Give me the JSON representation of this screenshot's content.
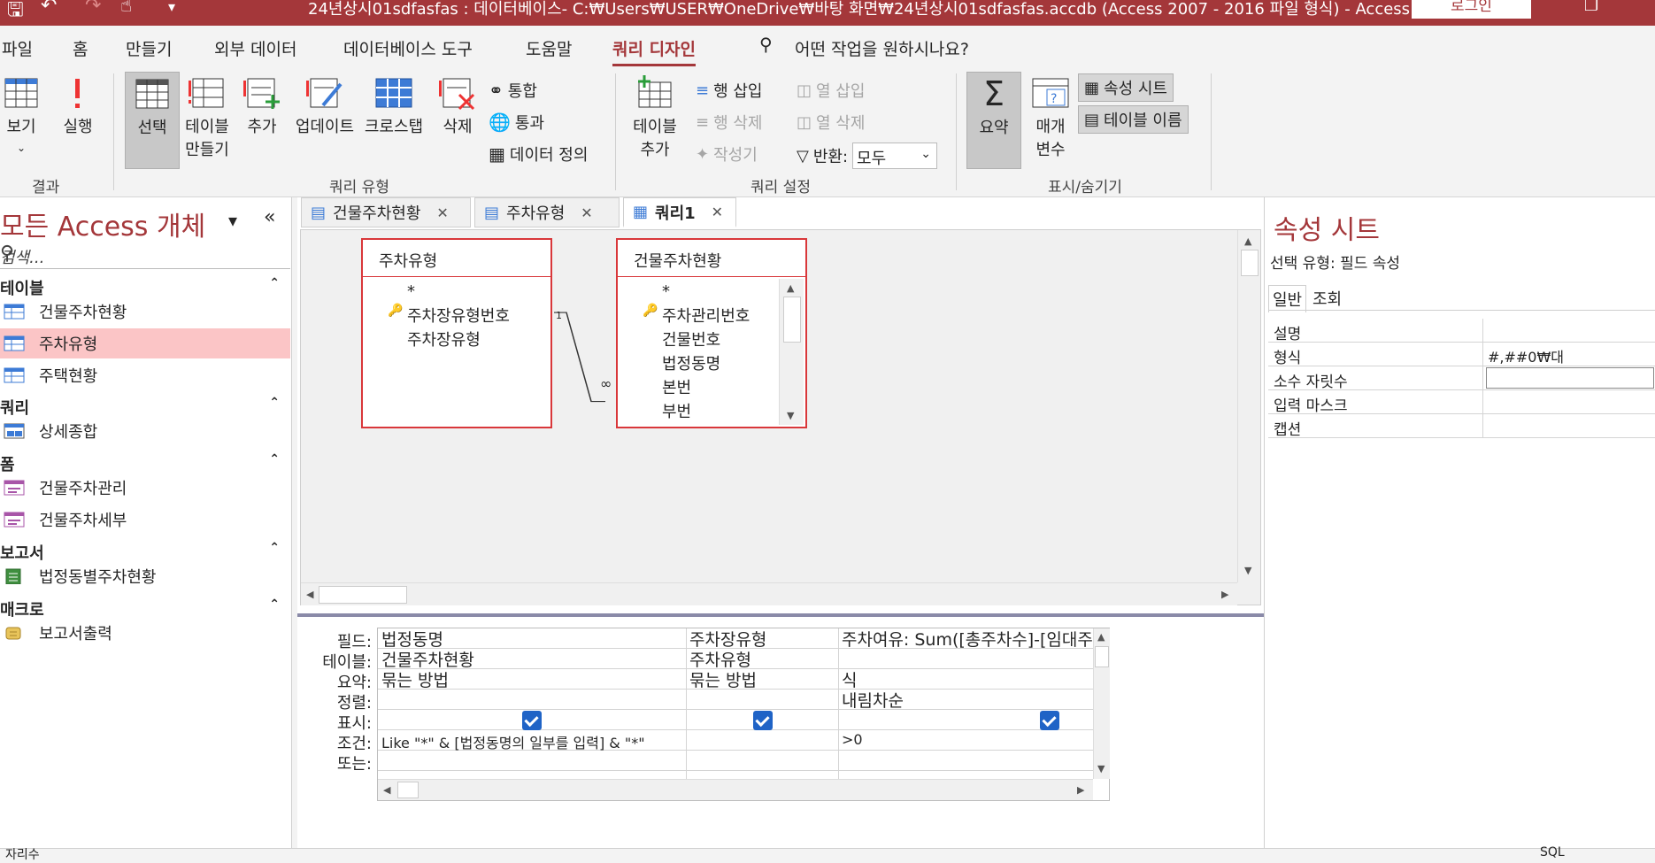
{
  "titlebar": {
    "title": "24년상시01sdfasfas : 데이터베이스- C:₩Users₩USER₩OneDrive₩바탕 화면₩24년상시01sdfasfas.accdb (Access 2007 - 2016 파일 형식) - Access",
    "login": "로그인"
  },
  "menu": {
    "tabs": [
      "파일",
      "홈",
      "만들기",
      "외부 데이터",
      "데이터베이스 도구",
      "도움말",
      "쿼리 디자인"
    ],
    "active": "쿼리 디자인",
    "tellme": "어떤 작업을 원하시나요?"
  },
  "ribbon": {
    "results": {
      "label": "결과",
      "view": "보기",
      "run": "실행"
    },
    "query_type": {
      "label": "쿼리 유형",
      "select": "선택",
      "make_table_1": "테이블",
      "make_table_2": "만들기",
      "append": "추가",
      "update": "업데이트",
      "crosstab": "크로스탭",
      "delete": "삭제",
      "union": "통합",
      "pass_through": "통과",
      "data_definition": "데이터 정의"
    },
    "query_setup": {
      "label": "쿼리 설정",
      "add_table_1": "테이블",
      "add_table_2": "추가",
      "insert_rows": "행 삽입",
      "delete_rows": "행 삭제",
      "builder": "작성기",
      "insert_cols": "열 삽입",
      "delete_cols": "열 삭제",
      "return_label": "반환:",
      "return_value": "모두"
    },
    "show_hide": {
      "label": "표시/숨기기",
      "totals": "요약",
      "params_1": "매개",
      "params_2": "변수",
      "property_sheet": "속성 시트",
      "table_names": "테이블 이름"
    }
  },
  "nav": {
    "title": "모든 Access 개체",
    "search_placeholder": "검색...",
    "groups": [
      {
        "name": "테이블",
        "items": [
          "건물주차현황",
          "주차유형",
          "주택현황"
        ]
      },
      {
        "name": "쿼리",
        "items": [
          "상세종합"
        ]
      },
      {
        "name": "폼",
        "items": [
          "건물주차관리",
          "건물주차세부"
        ]
      },
      {
        "name": "보고서",
        "items": [
          "법정동별주차현황"
        ]
      },
      {
        "name": "매크로",
        "items": [
          "보고서출력"
        ]
      }
    ],
    "selected": "주차유형"
  },
  "doctabs": [
    "건물주차현황",
    "주차유형",
    "쿼리1"
  ],
  "designer": {
    "table1": {
      "name": "주차유형",
      "fields": [
        "*",
        "주차장유형번호",
        "주차장유형"
      ]
    },
    "table2": {
      "name": "건물주차현황",
      "fields": [
        "*",
        "주차관리번호",
        "건물번호",
        "법정동명",
        "본번",
        "부번"
      ]
    },
    "join_one": "1",
    "join_many": "∞"
  },
  "grid": {
    "row_labels": [
      "필드:",
      "테이블:",
      "요약:",
      "정렬:",
      "표시:",
      "조건:",
      "또는:"
    ],
    "columns": [
      {
        "field": "법정동명",
        "table": "건물주차현황",
        "total": "묶는 방법",
        "sort": "",
        "show": true,
        "criteria": "Like \"*\" & [법정동명의 일부를 입력] & \"*\""
      },
      {
        "field": "주차장유형",
        "table": "주차유형",
        "total": "묶는 방법",
        "sort": "",
        "show": true,
        "criteria": ""
      },
      {
        "field": "주차여유: Sum([총주차수]-[임대주차수])",
        "table": "",
        "total": "식",
        "sort": "내림차순",
        "show": true,
        "criteria": ">0"
      }
    ]
  },
  "props": {
    "title": "속성 시트",
    "selection": "선택 유형: 필드 속성",
    "tabs": [
      "일반",
      "조회"
    ],
    "rows": [
      {
        "label": "설명",
        "value": ""
      },
      {
        "label": "형식",
        "value": "#,##0₩대"
      },
      {
        "label": "소수 자릿수",
        "value": ""
      },
      {
        "label": "입력 마스크",
        "value": ""
      },
      {
        "label": "캡션",
        "value": ""
      }
    ]
  },
  "statusbar": {
    "left": "자리수",
    "right": "SQL"
  }
}
